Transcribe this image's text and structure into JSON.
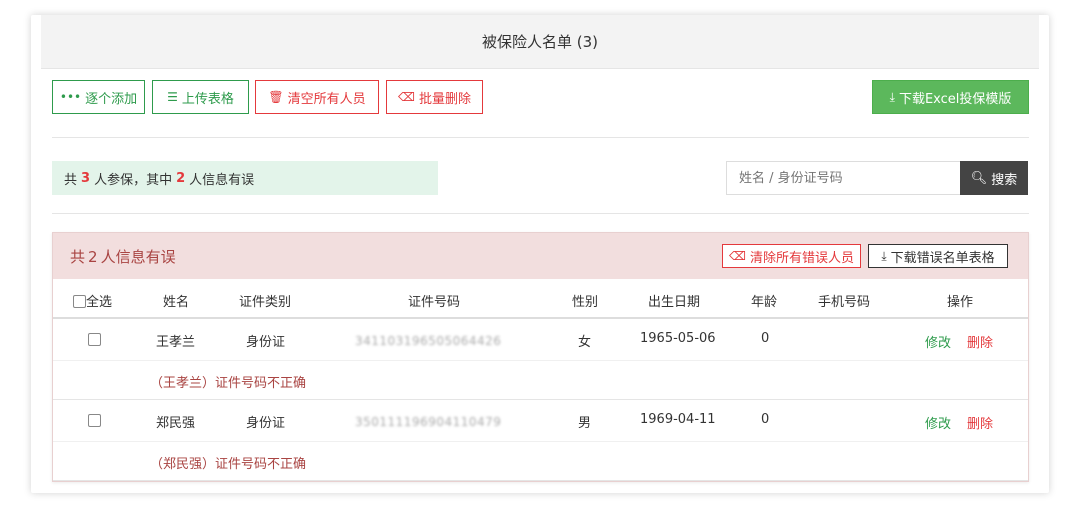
{
  "header": {
    "title": "被保险人名单 (3)"
  },
  "toolbar": {
    "add_one": "逐个添加",
    "upload": "上传表格",
    "clear_all": "清空所有人员",
    "batch_delete": "批量删除",
    "download_template": "下载Excel投保模版"
  },
  "summary": {
    "prefix": "共",
    "total": "3",
    "middle": "人参保，其中",
    "error_count": "2",
    "suffix": "人信息有误"
  },
  "search": {
    "placeholder": "姓名 / 身份证号码",
    "button": "搜索"
  },
  "error_panel": {
    "title_prefix": "共",
    "count": "2",
    "title_suffix": "人信息有误",
    "clear_errors": "清除所有错误人员",
    "download_errors": "下载错误名单表格"
  },
  "table": {
    "headers": {
      "select_all": "全选",
      "name": "姓名",
      "id_type": "证件类别",
      "id_number": "证件号码",
      "gender": "性别",
      "birth": "出生日期",
      "age": "年龄",
      "phone": "手机号码",
      "actions": "操作"
    },
    "rows": [
      {
        "name": "王孝兰",
        "id_type": "身份证",
        "id_number": "341103196505064426",
        "gender": "女",
        "birth": "1965-05-06",
        "age": "0",
        "phone": "",
        "edit": "修改",
        "delete": "删除",
        "error": "（王孝兰）证件号码不正确"
      },
      {
        "name": "郑民强",
        "id_type": "身份证",
        "id_number": "350111196904110479",
        "gender": "男",
        "birth": "1969-04-11",
        "age": "0",
        "phone": "",
        "edit": "修改",
        "delete": "删除",
        "error": "（郑民强）证件号码不正确"
      }
    ]
  },
  "colors": {
    "green": "#2e9b4c",
    "red": "#e4393c",
    "solid_green": "#5cb85c",
    "error_bg": "#f2dede",
    "error_text": "#a94442",
    "summary_bg": "#e3f4ea"
  }
}
